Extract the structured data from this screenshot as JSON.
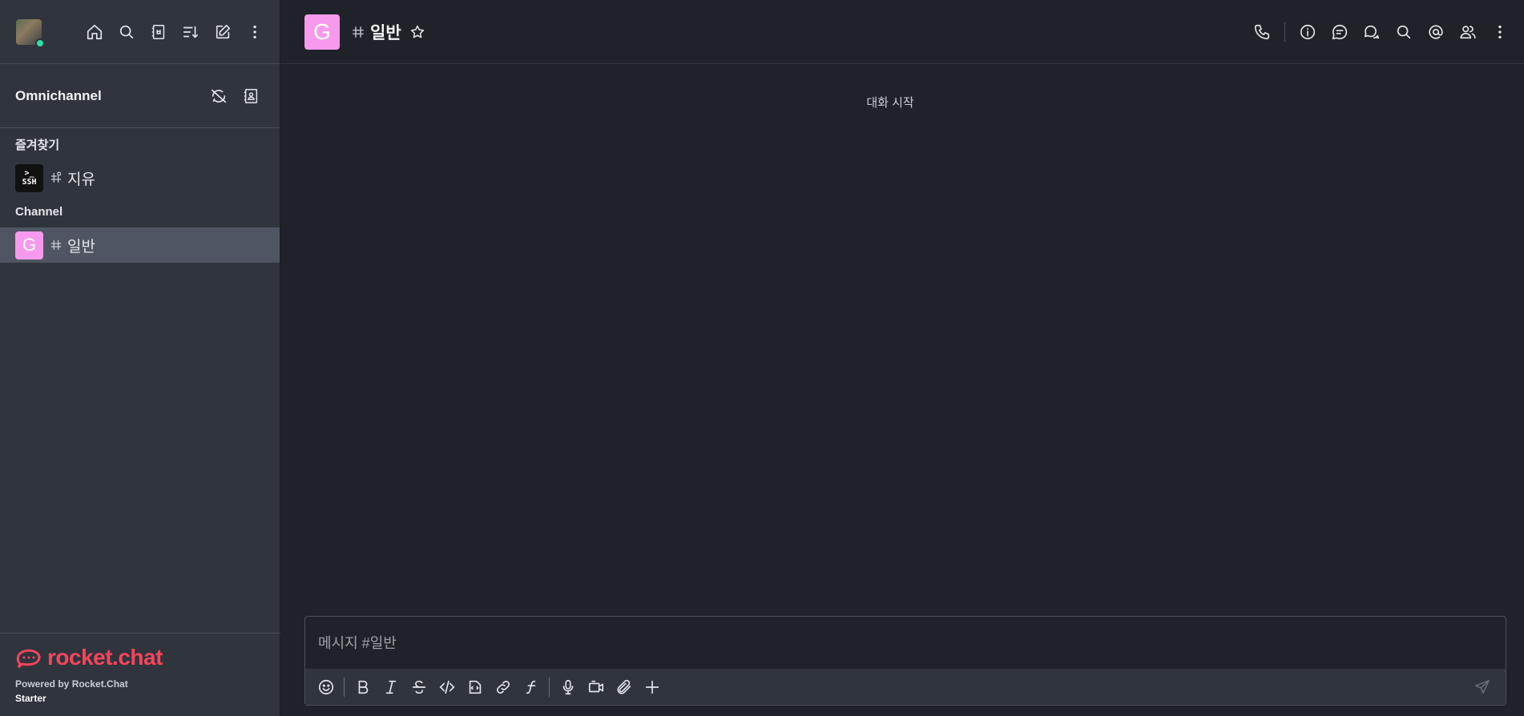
{
  "sidebar": {
    "top_icons": [
      "home-icon",
      "search-icon",
      "directory-icon",
      "sort-icon",
      "create-new-icon",
      "kebab-menu-icon"
    ],
    "omnichannel": {
      "title": "Omnichannel",
      "icons": [
        "omnichannel-off-icon",
        "contact-center-icon"
      ]
    },
    "sections": [
      {
        "label": "즐겨찾기",
        "rooms": [
          {
            "name": "지유",
            "avatar": "SSH"
          }
        ]
      },
      {
        "label": "Channel",
        "rooms": [
          {
            "name": "일반",
            "avatar": "G",
            "active": true
          }
        ]
      }
    ],
    "footer": {
      "brand": "rocket.chat",
      "powered": "Powered by Rocket.Chat",
      "plan": "Starter"
    }
  },
  "header": {
    "avatar_letter": "G",
    "title": "일반",
    "actions": [
      "call-icon",
      "info-icon",
      "threads-icon",
      "discussions-icon",
      "search-icon",
      "mentions-icon",
      "members-icon",
      "kebab-menu-icon"
    ]
  },
  "main": {
    "start_label": "대화 시작"
  },
  "composer": {
    "placeholder": "메시지 #일반",
    "toolbar": [
      "emoji-icon",
      "bold-icon",
      "italic-icon",
      "strikethrough-icon",
      "code-icon",
      "multiline-code-icon",
      "link-icon",
      "katex-icon",
      "microphone-icon",
      "video-message-icon",
      "attach-icon",
      "plus-icon",
      "send-icon"
    ]
  },
  "colors": {
    "brand": "#f5455c",
    "channel_avatar": "#f79aed",
    "online": "#2de0a5"
  }
}
